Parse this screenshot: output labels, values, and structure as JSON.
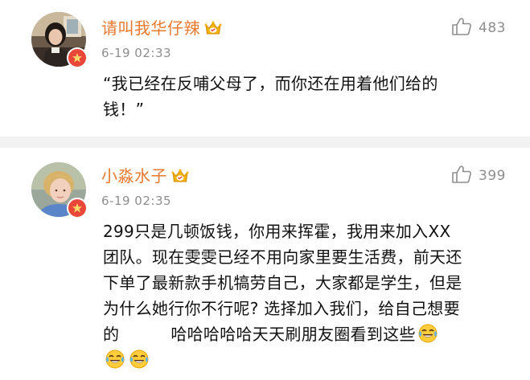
{
  "comments": [
    {
      "username": "请叫我华仔辣",
      "timestamp": "6-19 02:33",
      "likes": "483",
      "lines": [
        "“我已经在反哺父母了，而你还在用着他们给的",
        "钱！”"
      ],
      "icons": {
        "avatar": "avatar-girl",
        "badge": "vip-badge-icon",
        "crown": "crown-icon",
        "like": "thumbs-up-icon"
      }
    },
    {
      "username": "小淼水子",
      "timestamp": "6-19 02:35",
      "likes": "399",
      "lines": [
        "299只是几顿饭钱，你用来挥霍，我用来加入XX",
        "团队。现在雯雯已经不用向家里要生活费，前天还",
        "下单了最新款手机犒劳自己，大家都是学生，但是",
        "为什么她行你不行呢? 选择加入我们，给自己想要",
        "的",
        "哈哈哈哈哈天天刷朋友圈看到这些"
      ],
      "icons": {
        "avatar": "avatar-boy",
        "badge": "vip-badge-icon",
        "crown": "crown-icon",
        "like": "thumbs-up-icon",
        "emoji": "tears-of-joy-emoji-icon"
      }
    }
  ],
  "colors": {
    "username": "#e8792f",
    "meta": "#8e8e8e",
    "text": "#111111",
    "separator": "#f2f2f2",
    "badge": "#e8473a",
    "crown": "#f5b400"
  }
}
